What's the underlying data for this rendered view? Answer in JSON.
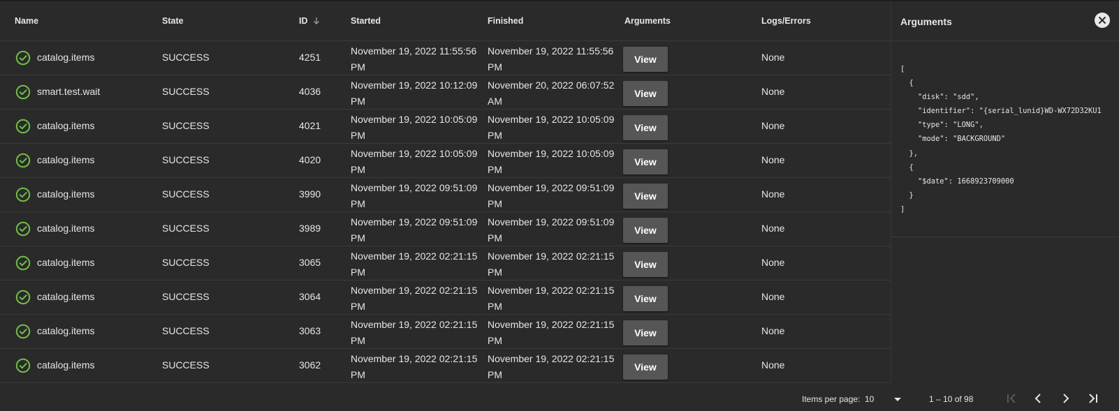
{
  "table": {
    "columns": {
      "name": "Name",
      "state": "State",
      "id": "ID",
      "started": "Started",
      "finished": "Finished",
      "arguments": "Arguments",
      "logs": "Logs/Errors"
    },
    "view_label": "View",
    "rows": [
      {
        "name": "catalog.items",
        "state": "SUCCESS",
        "id": "4251",
        "started": "November 19, 2022 11:55:56 PM",
        "finished": "November 19, 2022 11:55:56 PM",
        "logs": "None"
      },
      {
        "name": "smart.test.wait",
        "state": "SUCCESS",
        "id": "4036",
        "started": "November 19, 2022 10:12:09 PM",
        "finished": "November 20, 2022 06:07:52 AM",
        "logs": "None"
      },
      {
        "name": "catalog.items",
        "state": "SUCCESS",
        "id": "4021",
        "started": "November 19, 2022 10:05:09 PM",
        "finished": "November 19, 2022 10:05:09 PM",
        "logs": "None"
      },
      {
        "name": "catalog.items",
        "state": "SUCCESS",
        "id": "4020",
        "started": "November 19, 2022 10:05:09 PM",
        "finished": "November 19, 2022 10:05:09 PM",
        "logs": "None"
      },
      {
        "name": "catalog.items",
        "state": "SUCCESS",
        "id": "3990",
        "started": "November 19, 2022 09:51:09 PM",
        "finished": "November 19, 2022 09:51:09 PM",
        "logs": "None"
      },
      {
        "name": "catalog.items",
        "state": "SUCCESS",
        "id": "3989",
        "started": "November 19, 2022 09:51:09 PM",
        "finished": "November 19, 2022 09:51:09 PM",
        "logs": "None"
      },
      {
        "name": "catalog.items",
        "state": "SUCCESS",
        "id": "3065",
        "started": "November 19, 2022 02:21:15 PM",
        "finished": "November 19, 2022 02:21:15 PM",
        "logs": "None"
      },
      {
        "name": "catalog.items",
        "state": "SUCCESS",
        "id": "3064",
        "started": "November 19, 2022 02:21:15 PM",
        "finished": "November 19, 2022 02:21:15 PM",
        "logs": "None"
      },
      {
        "name": "catalog.items",
        "state": "SUCCESS",
        "id": "3063",
        "started": "November 19, 2022 02:21:15 PM",
        "finished": "November 19, 2022 02:21:15 PM",
        "logs": "None"
      },
      {
        "name": "catalog.items",
        "state": "SUCCESS",
        "id": "3062",
        "started": "November 19, 2022 02:21:15 PM",
        "finished": "November 19, 2022 02:21:15 PM",
        "logs": "None"
      }
    ]
  },
  "panel": {
    "title": "Arguments",
    "arguments_json": "[\n  {\n    \"disk\": \"sdd\",\n    \"identifier\": \"{serial_lunid}WD-WX72D32KU1\n    \"type\": \"LONG\",\n    \"mode\": \"BACKGROUND\"\n  },\n  {\n    \"$date\": 1668923709000\n  }\n]"
  },
  "paginator": {
    "items_per_page_label": "Items per page:",
    "page_size": "10",
    "range": "1 – 10 of 98"
  },
  "icons": {
    "status": "check-circle-icon",
    "sort": "arrow-down-icon",
    "close": "close-icon",
    "first": "first-page-icon",
    "prev": "chevron-left-icon",
    "next": "chevron-right-icon",
    "last": "last-page-icon"
  },
  "colors": {
    "background": "#2a2a2a",
    "success": "#71bf44",
    "button": "#565656",
    "text": "#e6e6e6"
  }
}
